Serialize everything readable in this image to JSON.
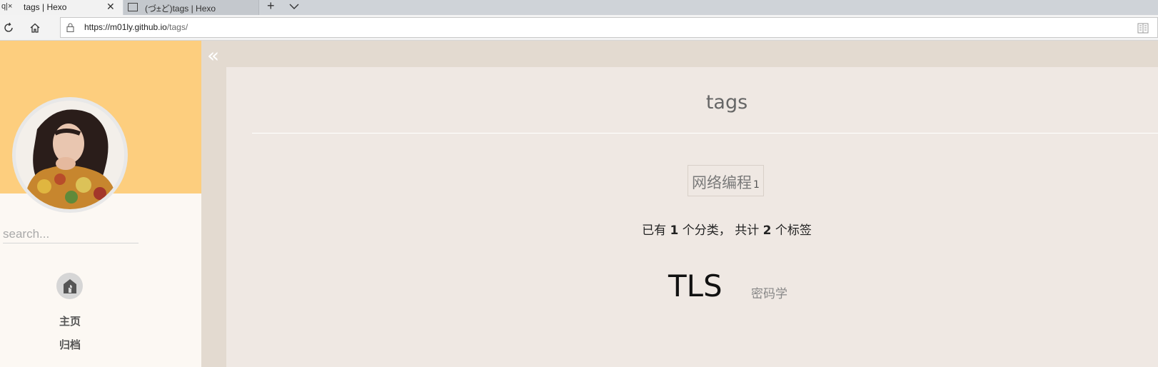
{
  "browser": {
    "tabs": [
      {
        "title": "tags | Hexo",
        "active": true
      },
      {
        "title": "(づ±ど)tags | Hexo",
        "active": false
      }
    ],
    "url": {
      "host": "https://m01ly.github.io",
      "path": "/tags/"
    }
  },
  "sidebar": {
    "search_placeholder": "search...",
    "menu": [
      {
        "label": "主页",
        "icon": "home-icon"
      },
      {
        "label": "归档"
      }
    ]
  },
  "main": {
    "title": "tags",
    "category": {
      "name": "网络编程",
      "count": "1"
    },
    "summary": {
      "prefix": "已有",
      "categories": "1",
      "middle": "个分类，  共计",
      "tags": "2",
      "suffix": "个标签"
    },
    "tags": [
      {
        "label": "TLS",
        "size": "large"
      },
      {
        "label": "密码学",
        "size": "small"
      }
    ]
  },
  "colors": {
    "sidebar_banner": "#fdce7e",
    "main_background": "#e3dad0",
    "content_background": "#efe8e3"
  }
}
